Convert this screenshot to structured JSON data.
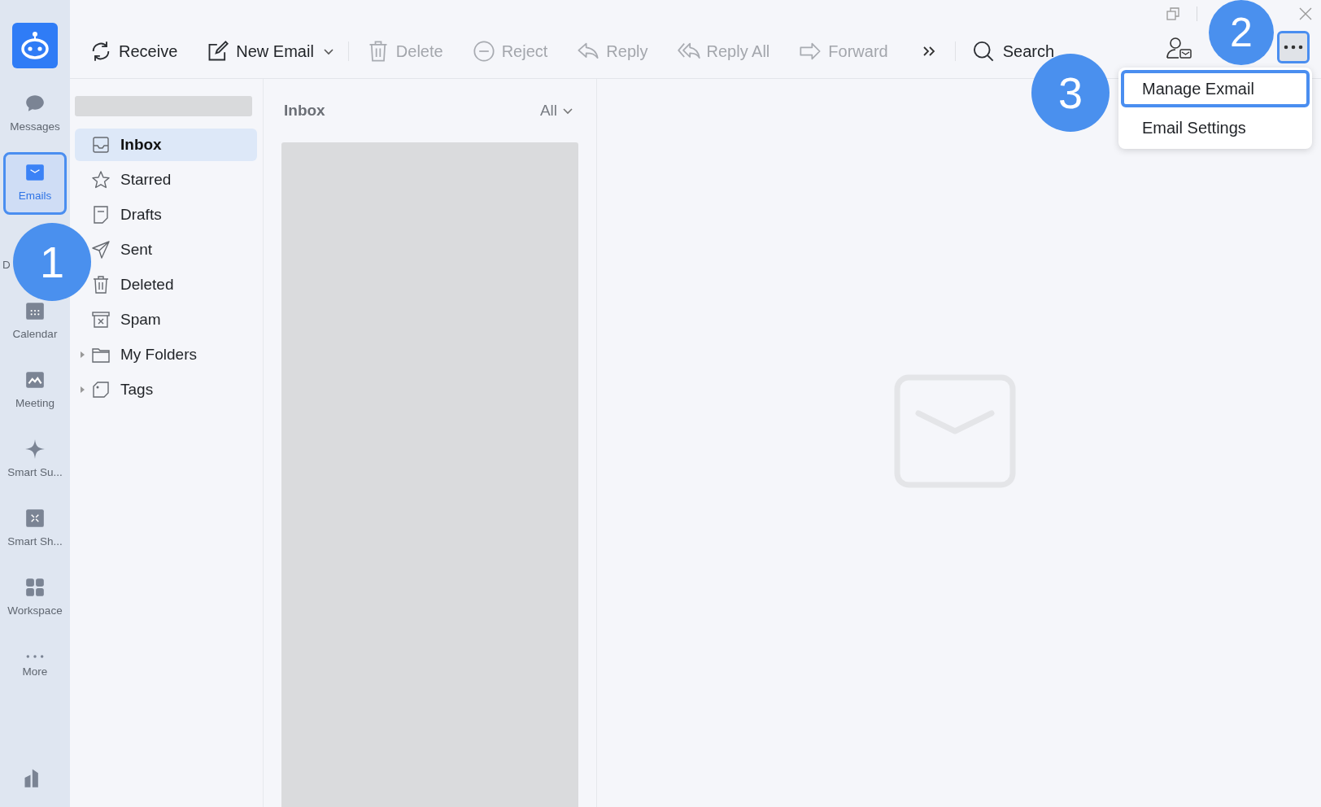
{
  "nav": [
    {
      "kind": "logo"
    },
    {
      "kind": "messages",
      "label": "Messages",
      "selected": false
    },
    {
      "kind": "emails",
      "label": "Emails",
      "selected": true
    },
    {
      "kind": "docs",
      "label": "D",
      "selected": false
    },
    {
      "kind": "calendar",
      "label": "Calendar",
      "selected": false
    },
    {
      "kind": "meeting",
      "label": "Meeting",
      "selected": false
    },
    {
      "kind": "sparkle",
      "label": "Smart Su...",
      "selected": false
    },
    {
      "kind": "share",
      "label": "Smart Sh...",
      "selected": false
    },
    {
      "kind": "workspace",
      "label": "Workspace",
      "selected": false
    },
    {
      "kind": "more",
      "label": "More",
      "selected": false
    }
  ],
  "toolbar": [
    {
      "kind": "receive",
      "label": "Receive",
      "disabled": false
    },
    {
      "kind": "compose",
      "label": "New Email",
      "disabled": false
    },
    {
      "kind": "delete",
      "label": "Delete",
      "disabled": true
    },
    {
      "kind": "reject",
      "label": "Reject",
      "disabled": true
    },
    {
      "kind": "reply",
      "label": "Reply",
      "disabled": true
    },
    {
      "kind": "replyall",
      "label": "Reply All",
      "disabled": true
    },
    {
      "kind": "forward",
      "label": "Forward",
      "disabled": true
    }
  ],
  "search": {
    "label": "Search"
  },
  "folders": [
    {
      "kind": "inbox",
      "label": "Inbox",
      "selected": true
    },
    {
      "kind": "star",
      "label": "Starred",
      "selected": false
    },
    {
      "kind": "draft",
      "label": "Drafts",
      "selected": false
    },
    {
      "kind": "sent",
      "label": "Sent",
      "selected": false
    },
    {
      "kind": "trash",
      "label": "Deleted",
      "selected": false
    },
    {
      "kind": "spam",
      "label": "Spam",
      "selected": false
    },
    {
      "kind": "folder",
      "label": "My Folders",
      "selected": false,
      "expanded": false
    },
    {
      "kind": "tag",
      "label": "Tags",
      "selected": false,
      "expanded": false
    }
  ],
  "list": {
    "title": "Inbox",
    "filter": "All"
  },
  "menu": [
    {
      "label": "Manage Exmail",
      "selected": true
    },
    {
      "label": "Email Settings",
      "selected": false
    }
  ],
  "callouts": [
    "1",
    "2",
    "3"
  ]
}
